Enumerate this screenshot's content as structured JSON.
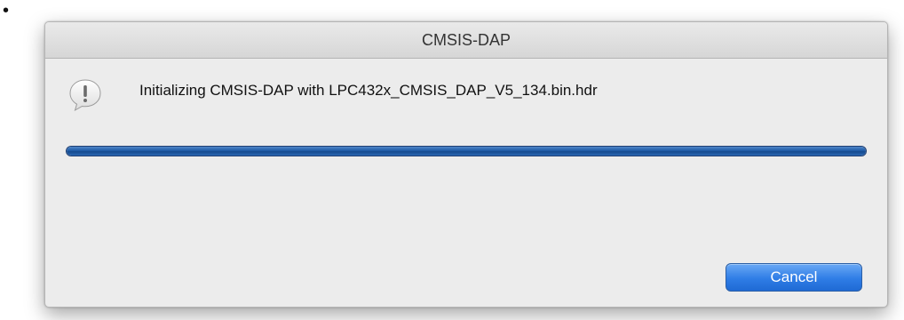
{
  "page": {
    "bullet": "•"
  },
  "dialog": {
    "title": "CMSIS-DAP",
    "message": "Initializing CMSIS-DAP with LPC432x_CMSIS_DAP_V5_134.bin.hdr",
    "icon": "alert-speech-bubble-icon",
    "progress": {
      "value": 1.0
    },
    "cancel_label": "Cancel"
  },
  "colors": {
    "accent": "#1f5ca8",
    "button": "#2f7de6"
  }
}
